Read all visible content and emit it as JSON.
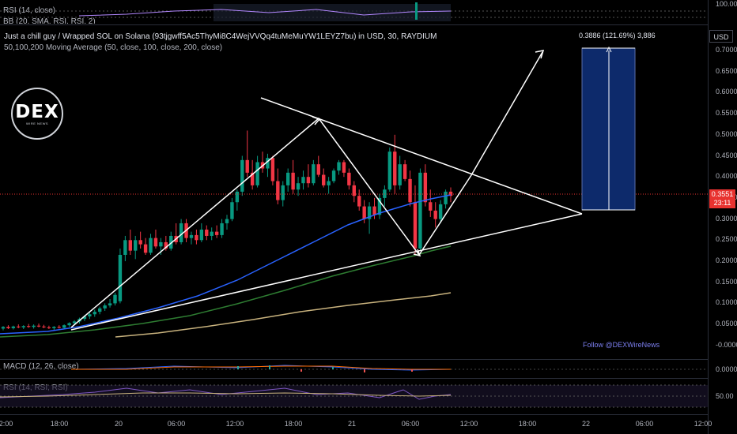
{
  "top_indicators": {
    "rsi_label": "RSI (14, close)",
    "bb_label": "BB (20, SMA, RSI, RSI, 2)",
    "axis_value": "100.00"
  },
  "header": {
    "title": "Just a chill guy / Wrapped SOL on Solana (93tjgwff5Ac5ThyMi8C4WejVVQq4tuMeMuYW1LEYZ7bu) in USD, 30, RAYDIUM",
    "ma_label": "50,100,200 Moving Average (50, close, 100, close, 200, close)"
  },
  "currency_button": "USD",
  "logo": {
    "main": "DEX",
    "sub": "WIRE NEWS"
  },
  "watermark": "Follow @DEXWireNews",
  "measure_label": "0.3886 (121.69%) 3,886",
  "last_price": {
    "value": "0.3551",
    "countdown": "23:11"
  },
  "price_axis": [
    "0.7000",
    "0.6500",
    "0.6000",
    "0.5500",
    "0.5000",
    "0.4500",
    "0.4000",
    "0.3500",
    "0.3000",
    "0.2500",
    "0.2000",
    "0.1500",
    "0.1000",
    "0.0500",
    "-0.0000"
  ],
  "macd": {
    "label": "MACD (12, 26, close)",
    "axis_value": "0.0000"
  },
  "rsi": {
    "label": "RSI (14, RSI, RSI)",
    "axis_value": "50.00"
  },
  "time_axis": [
    "12:00",
    "18:00",
    "20",
    "06:00",
    "12:00",
    "18:00",
    "21",
    "06:00",
    "12:00",
    "18:00",
    "22",
    "06:00",
    "12:00"
  ],
  "colors": {
    "bull": "#089981",
    "bear": "#f23645",
    "ma50": "#2962ff",
    "ma100": "#1b5e20",
    "ma200": "#c9b37e",
    "measure": "#0d2a6b",
    "price_line": "#e8322f"
  },
  "chart_data": {
    "type": "candlestick",
    "interval": "30",
    "ylim": [
      -0.02,
      0.75
    ],
    "candles": [
      {
        "o": 0.04,
        "h": 0.046,
        "l": 0.036,
        "c": 0.044
      },
      {
        "o": 0.044,
        "h": 0.048,
        "l": 0.039,
        "c": 0.041
      },
      {
        "o": 0.041,
        "h": 0.047,
        "l": 0.038,
        "c": 0.045
      },
      {
        "o": 0.045,
        "h": 0.05,
        "l": 0.041,
        "c": 0.043
      },
      {
        "o": 0.043,
        "h": 0.048,
        "l": 0.039,
        "c": 0.046
      },
      {
        "o": 0.046,
        "h": 0.051,
        "l": 0.042,
        "c": 0.044
      },
      {
        "o": 0.044,
        "h": 0.05,
        "l": 0.04,
        "c": 0.047
      },
      {
        "o": 0.047,
        "h": 0.052,
        "l": 0.043,
        "c": 0.045
      },
      {
        "o": 0.045,
        "h": 0.049,
        "l": 0.041,
        "c": 0.043
      },
      {
        "o": 0.043,
        "h": 0.047,
        "l": 0.039,
        "c": 0.041
      },
      {
        "o": 0.041,
        "h": 0.046,
        "l": 0.037,
        "c": 0.044
      },
      {
        "o": 0.044,
        "h": 0.048,
        "l": 0.04,
        "c": 0.042
      },
      {
        "o": 0.042,
        "h": 0.05,
        "l": 0.04,
        "c": 0.048
      },
      {
        "o": 0.048,
        "h": 0.055,
        "l": 0.044,
        "c": 0.053
      },
      {
        "o": 0.053,
        "h": 0.06,
        "l": 0.049,
        "c": 0.057
      },
      {
        "o": 0.057,
        "h": 0.066,
        "l": 0.052,
        "c": 0.063
      },
      {
        "o": 0.063,
        "h": 0.072,
        "l": 0.058,
        "c": 0.069
      },
      {
        "o": 0.069,
        "h": 0.078,
        "l": 0.063,
        "c": 0.074
      },
      {
        "o": 0.074,
        "h": 0.085,
        "l": 0.068,
        "c": 0.08
      },
      {
        "o": 0.08,
        "h": 0.092,
        "l": 0.074,
        "c": 0.088
      },
      {
        "o": 0.088,
        "h": 0.1,
        "l": 0.082,
        "c": 0.095
      },
      {
        "o": 0.095,
        "h": 0.11,
        "l": 0.09,
        "c": 0.1
      },
      {
        "o": 0.1,
        "h": 0.125,
        "l": 0.095,
        "c": 0.12
      },
      {
        "o": 0.105,
        "h": 0.23,
        "l": 0.1,
        "c": 0.215
      },
      {
        "o": 0.215,
        "h": 0.26,
        "l": 0.2,
        "c": 0.25
      },
      {
        "o": 0.25,
        "h": 0.275,
        "l": 0.215,
        "c": 0.225
      },
      {
        "o": 0.225,
        "h": 0.26,
        "l": 0.205,
        "c": 0.25
      },
      {
        "o": 0.25,
        "h": 0.27,
        "l": 0.23,
        "c": 0.24
      },
      {
        "o": 0.24,
        "h": 0.255,
        "l": 0.215,
        "c": 0.22
      },
      {
        "o": 0.22,
        "h": 0.265,
        "l": 0.215,
        "c": 0.255
      },
      {
        "o": 0.255,
        "h": 0.275,
        "l": 0.23,
        "c": 0.235
      },
      {
        "o": 0.235,
        "h": 0.255,
        "l": 0.215,
        "c": 0.245
      },
      {
        "o": 0.245,
        "h": 0.26,
        "l": 0.225,
        "c": 0.23
      },
      {
        "o": 0.23,
        "h": 0.27,
        "l": 0.225,
        "c": 0.26
      },
      {
        "o": 0.26,
        "h": 0.29,
        "l": 0.24,
        "c": 0.245
      },
      {
        "o": 0.245,
        "h": 0.3,
        "l": 0.24,
        "c": 0.29
      },
      {
        "o": 0.29,
        "h": 0.3,
        "l": 0.245,
        "c": 0.255
      },
      {
        "o": 0.255,
        "h": 0.27,
        "l": 0.24,
        "c": 0.262
      },
      {
        "o": 0.262,
        "h": 0.275,
        "l": 0.24,
        "c": 0.25
      },
      {
        "o": 0.25,
        "h": 0.29,
        "l": 0.245,
        "c": 0.275
      },
      {
        "o": 0.275,
        "h": 0.285,
        "l": 0.25,
        "c": 0.26
      },
      {
        "o": 0.26,
        "h": 0.28,
        "l": 0.25,
        "c": 0.27
      },
      {
        "o": 0.27,
        "h": 0.285,
        "l": 0.255,
        "c": 0.262
      },
      {
        "o": 0.262,
        "h": 0.3,
        "l": 0.255,
        "c": 0.29
      },
      {
        "o": 0.29,
        "h": 0.31,
        "l": 0.275,
        "c": 0.3
      },
      {
        "o": 0.3,
        "h": 0.35,
        "l": 0.295,
        "c": 0.34
      },
      {
        "o": 0.34,
        "h": 0.37,
        "l": 0.32,
        "c": 0.365
      },
      {
        "o": 0.365,
        "h": 0.45,
        "l": 0.355,
        "c": 0.44
      },
      {
        "o": 0.44,
        "h": 0.51,
        "l": 0.4,
        "c": 0.41
      },
      {
        "o": 0.41,
        "h": 0.44,
        "l": 0.37,
        "c": 0.38
      },
      {
        "o": 0.38,
        "h": 0.45,
        "l": 0.375,
        "c": 0.435
      },
      {
        "o": 0.435,
        "h": 0.46,
        "l": 0.41,
        "c": 0.42
      },
      {
        "o": 0.42,
        "h": 0.455,
        "l": 0.4,
        "c": 0.445
      },
      {
        "o": 0.445,
        "h": 0.45,
        "l": 0.38,
        "c": 0.39
      },
      {
        "o": 0.39,
        "h": 0.42,
        "l": 0.335,
        "c": 0.345
      },
      {
        "o": 0.345,
        "h": 0.39,
        "l": 0.33,
        "c": 0.38
      },
      {
        "o": 0.38,
        "h": 0.42,
        "l": 0.365,
        "c": 0.41
      },
      {
        "o": 0.41,
        "h": 0.44,
        "l": 0.36,
        "c": 0.37
      },
      {
        "o": 0.37,
        "h": 0.4,
        "l": 0.355,
        "c": 0.385
      },
      {
        "o": 0.385,
        "h": 0.415,
        "l": 0.37,
        "c": 0.4
      },
      {
        "o": 0.4,
        "h": 0.43,
        "l": 0.375,
        "c": 0.385
      },
      {
        "o": 0.385,
        "h": 0.44,
        "l": 0.38,
        "c": 0.43
      },
      {
        "o": 0.43,
        "h": 0.45,
        "l": 0.4,
        "c": 0.405
      },
      {
        "o": 0.405,
        "h": 0.42,
        "l": 0.375,
        "c": 0.38
      },
      {
        "o": 0.38,
        "h": 0.4,
        "l": 0.36,
        "c": 0.39
      },
      {
        "o": 0.39,
        "h": 0.42,
        "l": 0.385,
        "c": 0.415
      },
      {
        "o": 0.415,
        "h": 0.44,
        "l": 0.405,
        "c": 0.435
      },
      {
        "o": 0.435,
        "h": 0.44,
        "l": 0.4,
        "c": 0.41
      },
      {
        "o": 0.41,
        "h": 0.42,
        "l": 0.37,
        "c": 0.38
      },
      {
        "o": 0.38,
        "h": 0.39,
        "l": 0.34,
        "c": 0.355
      },
      {
        "o": 0.355,
        "h": 0.37,
        "l": 0.32,
        "c": 0.33
      },
      {
        "o": 0.33,
        "h": 0.345,
        "l": 0.29,
        "c": 0.3
      },
      {
        "o": 0.3,
        "h": 0.34,
        "l": 0.265,
        "c": 0.33
      },
      {
        "o": 0.33,
        "h": 0.35,
        "l": 0.3,
        "c": 0.31
      },
      {
        "o": 0.31,
        "h": 0.36,
        "l": 0.3,
        "c": 0.35
      },
      {
        "o": 0.35,
        "h": 0.38,
        "l": 0.33,
        "c": 0.37
      },
      {
        "o": 0.37,
        "h": 0.47,
        "l": 0.365,
        "c": 0.46
      },
      {
        "o": 0.46,
        "h": 0.5,
        "l": 0.36,
        "c": 0.38
      },
      {
        "o": 0.38,
        "h": 0.45,
        "l": 0.37,
        "c": 0.43
      },
      {
        "o": 0.43,
        "h": 0.44,
        "l": 0.39,
        "c": 0.395
      },
      {
        "o": 0.395,
        "h": 0.415,
        "l": 0.33,
        "c": 0.34
      },
      {
        "o": 0.34,
        "h": 0.38,
        "l": 0.215,
        "c": 0.23
      },
      {
        "o": 0.23,
        "h": 0.42,
        "l": 0.225,
        "c": 0.41
      },
      {
        "o": 0.41,
        "h": 0.43,
        "l": 0.33,
        "c": 0.34
      },
      {
        "o": 0.34,
        "h": 0.37,
        "l": 0.305,
        "c": 0.32
      },
      {
        "o": 0.32,
        "h": 0.34,
        "l": 0.28,
        "c": 0.3
      },
      {
        "o": 0.3,
        "h": 0.345,
        "l": 0.29,
        "c": 0.335
      },
      {
        "o": 0.335,
        "h": 0.37,
        "l": 0.325,
        "c": 0.365
      },
      {
        "o": 0.365,
        "h": 0.375,
        "l": 0.34,
        "c": 0.3551
      }
    ]
  }
}
